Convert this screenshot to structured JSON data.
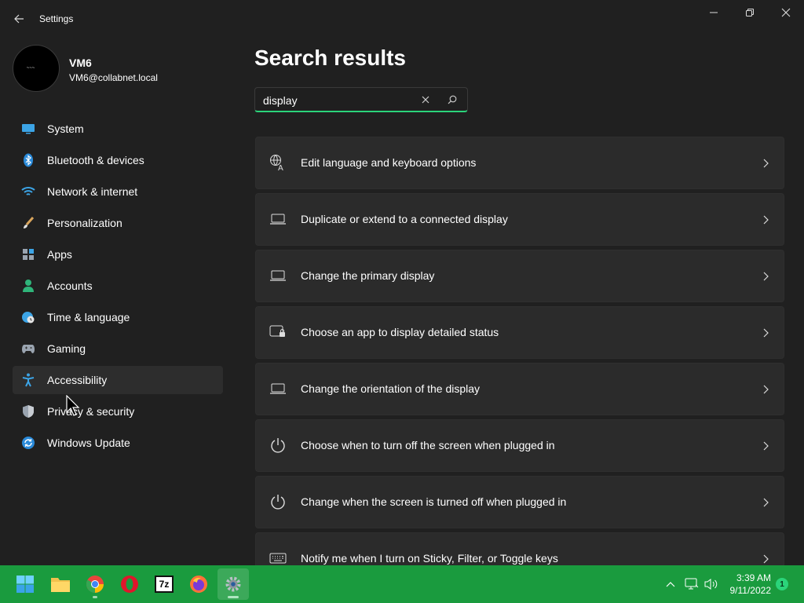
{
  "window": {
    "title": "Settings"
  },
  "profile": {
    "name": "VM6",
    "email": "VM6@collabnet.local"
  },
  "sidebar": {
    "items": [
      {
        "label": "System",
        "icon": "system-icon"
      },
      {
        "label": "Bluetooth & devices",
        "icon": "bluetooth-icon"
      },
      {
        "label": "Network & internet",
        "icon": "wifi-icon"
      },
      {
        "label": "Personalization",
        "icon": "brush-icon"
      },
      {
        "label": "Apps",
        "icon": "apps-icon"
      },
      {
        "label": "Accounts",
        "icon": "accounts-icon"
      },
      {
        "label": "Time & language",
        "icon": "globe-clock-icon"
      },
      {
        "label": "Gaming",
        "icon": "gamepad-icon"
      },
      {
        "label": "Accessibility",
        "icon": "accessibility-icon"
      },
      {
        "label": "Privacy & security",
        "icon": "shield-icon"
      },
      {
        "label": "Windows Update",
        "icon": "update-icon"
      }
    ]
  },
  "main": {
    "title": "Search results",
    "search": {
      "value": "display"
    },
    "results": [
      {
        "label": "Edit language and keyboard options",
        "icon": "language-icon"
      },
      {
        "label": "Duplicate or extend to a connected display",
        "icon": "laptop-icon"
      },
      {
        "label": "Change the primary display",
        "icon": "laptop-icon"
      },
      {
        "label": "Choose an app to display detailed status",
        "icon": "lock-screen-icon"
      },
      {
        "label": "Change the orientation of the display",
        "icon": "laptop-icon"
      },
      {
        "label": "Choose when to turn off the screen when plugged in",
        "icon": "power-icon"
      },
      {
        "label": "Change when the screen is turned off when plugged in",
        "icon": "power-icon"
      },
      {
        "label": "Notify me when I turn on Sticky, Filter, or Toggle keys",
        "icon": "keyboard-icon"
      }
    ]
  },
  "taskbar": {
    "apps": [
      "start-icon",
      "file-explorer-icon",
      "chrome-icon",
      "opera-icon",
      "7zip-icon",
      "firefox-icon",
      "settings-icon"
    ],
    "zip_label": "7z",
    "clock": {
      "time": "3:39 AM",
      "date": "9/11/2022"
    },
    "notifications": "1"
  },
  "colors": {
    "accent": "#2bd47a",
    "taskbar": "#1a9b3e",
    "background": "#202020",
    "card": "#2b2b2b"
  }
}
